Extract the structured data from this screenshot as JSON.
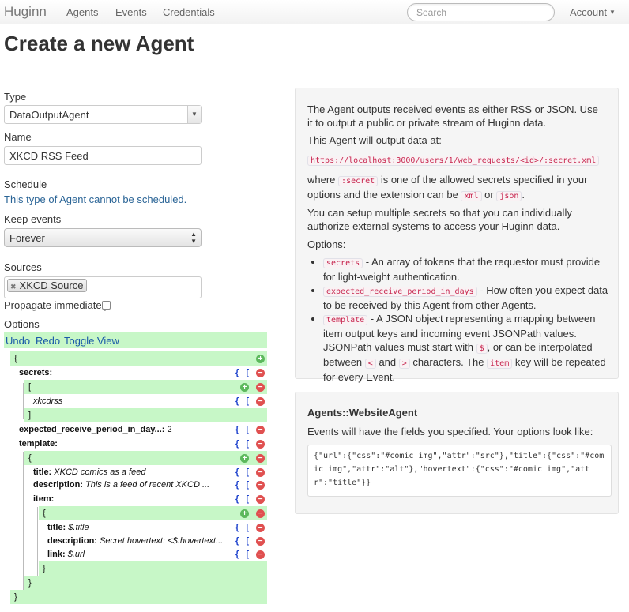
{
  "navbar": {
    "brand": "Huginn",
    "links": [
      "Agents",
      "Events",
      "Credentials"
    ],
    "search_placeholder": "Search",
    "account_label": "Account"
  },
  "page_title": "Create a new Agent",
  "form": {
    "type_label": "Type",
    "type_value": "DataOutputAgent",
    "name_label": "Name",
    "name_value": "XKCD RSS Feed",
    "schedule_label": "Schedule",
    "schedule_note": "This type of Agent cannot be scheduled.",
    "keep_events_label": "Keep events",
    "keep_events_value": "Forever",
    "sources_label": "Sources",
    "source_chip": "XKCD Source",
    "propagate_label": "Propagate immediately",
    "propagate_checked": false,
    "options_label": "Options"
  },
  "editor": {
    "undo": "Undo",
    "redo": "Redo",
    "toggle": "Toggle View",
    "open_brace": "{",
    "close_brace": "}",
    "open_bracket": "[",
    "close_bracket": "]",
    "controls": "{ [",
    "secrets_key": "secrets:",
    "secrets_item": "xkcdrss",
    "period_key": "expected_receive_period_in_day...:",
    "period_value": "2",
    "template_key": "template:",
    "title_key": "title:",
    "title_value": "XKCD comics as a feed",
    "description_key": "description:",
    "description_value": "This is a feed of recent XKCD ...",
    "item_key": "item:",
    "item_title_key": "title:",
    "item_title_value": "$.title",
    "item_desc_key": "description:",
    "item_desc_value": "Secret hovertext: <$.hovertext...",
    "item_link_key": "link:",
    "item_link_value": "$.url"
  },
  "help": {
    "intro": "The Agent outputs received events as either RSS or JSON. Use it to output a public or private stream of Huginn data.",
    "output_at": "This Agent will output data at:",
    "url": "https://localhost:3000/users/1/web_requests/<id>/:secret.xml",
    "where_1": "where",
    "secret_code": ":secret",
    "where_2": "is one of the allowed secrets specified in your options and the extension can be",
    "xml_code": "xml",
    "or_text": "or",
    "json_code": "json",
    "multi_secrets": "You can setup multiple secrets so that you can individually authorize external systems to access your Huginn data.",
    "options_heading": "Options:",
    "opt1_code": "secrets",
    "opt1_text": "- An array of tokens that the requestor must provide for light-weight authentication.",
    "opt2_code": "expected_receive_period_in_days",
    "opt2_text": "- How often you expect data to be received by this Agent from other Agents.",
    "opt3_code": "template",
    "opt3_text_1": "- A JSON object representing a mapping between item output keys and incoming event JSONPath values. JSONPath values must start with",
    "opt3_dollar": "$",
    "opt3_text_2": ", or can be interpolated between",
    "opt3_lt": "<",
    "opt3_and": "and",
    "opt3_gt": ">",
    "opt3_text_3": "characters. The",
    "opt3_item": "item",
    "opt3_text_4": "key will be repeated for every Event."
  },
  "source_panel": {
    "title": "Agents::WebsiteAgent",
    "text": "Events will have the fields you specified. Your options look like:",
    "code": "{\"url\":{\"css\":\"#comic img\",\"attr\":\"src\"},\"title\":{\"css\":\"#comic img\",\"attr\":\"alt\"},\"hovertext\":{\"css\":\"#comic img\",\"attr\":\"title\"}}"
  }
}
